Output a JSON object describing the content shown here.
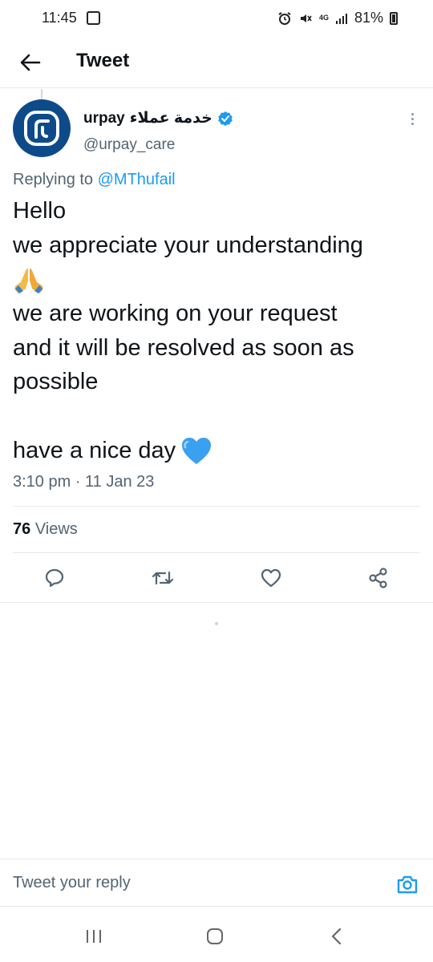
{
  "status_bar": {
    "time": "11:45",
    "network": "4G",
    "battery": "81%"
  },
  "header": {
    "title": "Tweet",
    "back_icon": "arrow-left-icon"
  },
  "tweet": {
    "author_name": "urpay",
    "author_name_arabic": "خدمة عملاء",
    "handle": "@urpay_care",
    "replying_to_label": "Replying to",
    "replying_to_handle": "@MThufail",
    "lines": [
      "Hello",
      "we appreciate your understanding",
      "",
      "we are working on your request",
      "and it will be resolved as soon as",
      "possible",
      "",
      "have a nice day"
    ],
    "emojis": [
      "folded-hands-emoji",
      "blue-heart-emoji"
    ],
    "timestamp": "3:10 pm · 11 Jan 23",
    "views_count": "76",
    "views_label": "Views"
  },
  "actions": [
    "reply-icon",
    "retweet-icon",
    "like-icon",
    "share-icon"
  ],
  "reply_bar": {
    "placeholder": "Tweet your reply",
    "camera_icon": "camera-icon"
  },
  "colors": {
    "accent": "#1d9bf0",
    "text": "#0f1419",
    "secondary": "#536471",
    "avatar_bg": "#0d4a8a"
  }
}
